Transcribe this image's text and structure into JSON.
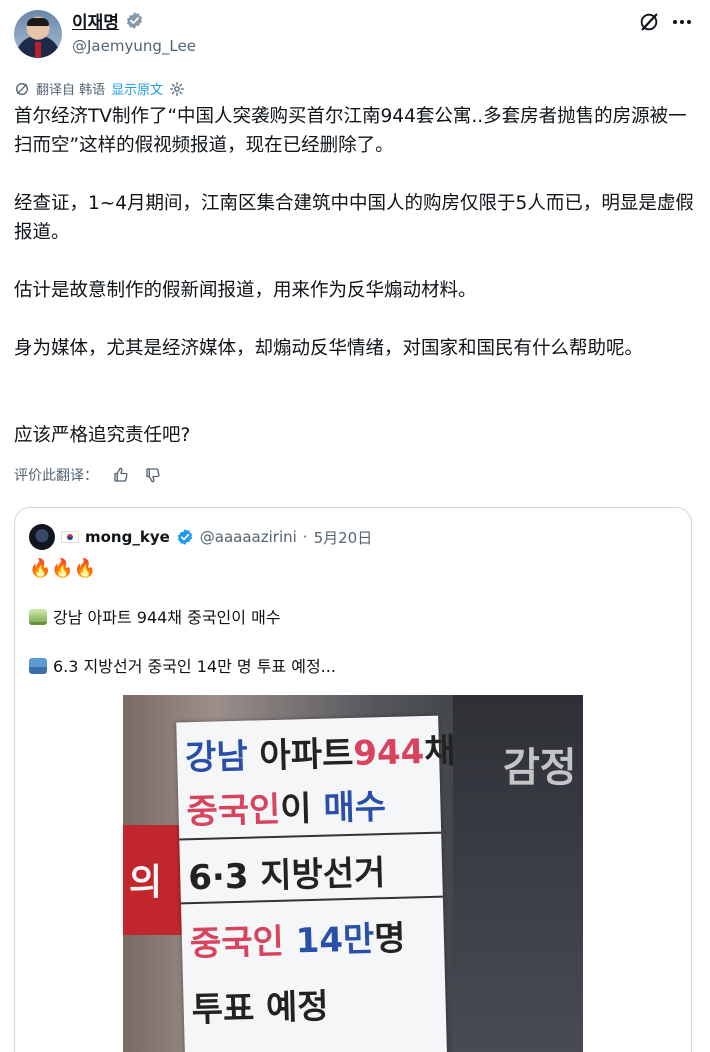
{
  "author": {
    "display_name": "이재명",
    "handle": "@Jaemyung_Lee"
  },
  "translation": {
    "label": "翻译自 韩语",
    "show_original": "显示原文"
  },
  "tweet": {
    "paragraphs": [
      "首尔经济TV制作了“中国人突袭购买首尔江南944套公寓..多套房者抛售的房源被一扫而空”这样的假视频报道，现在已经删除了。",
      "经查证，1~4月期间，江南区集合建筑中中国人的购房仅限于5人而已，明显是虚假报道。",
      "估计是故意制作的假新闻报道，用来作为反华煽动材料。",
      "身为媒体，尤其是经济媒体，却煽动反华情绪，对国家和国民有什么帮助呢。",
      "应该严格追究责任吧?"
    ]
  },
  "rate_translation": {
    "label": "评价此翻译："
  },
  "quoted": {
    "name": "mong_kye",
    "handle": "@aaaaazirini",
    "separator": "·",
    "date": "5月20日",
    "fire": "🔥🔥🔥",
    "line1": "강남 아파트 944채 중국인이 매수",
    "line2": "6.3 지방선거 중국인 14만 명 투표 예정..."
  },
  "photo": {
    "board_lines": [
      {
        "parts": [
          {
            "t": "강남",
            "c": "blue"
          },
          {
            "t": " 아파트",
            "c": "blk"
          },
          {
            "t": "944",
            "c": "red"
          },
          {
            "t": "채",
            "c": "blk"
          }
        ]
      },
      {
        "parts": [
          {
            "t": "중국인",
            "c": "red"
          },
          {
            "t": "이 ",
            "c": "blk"
          },
          {
            "t": "매수",
            "c": "blue"
          }
        ]
      },
      {
        "parts": [
          {
            "t": "6·3 지방선거",
            "c": "blk"
          }
        ]
      },
      {
        "parts": [
          {
            "t": "중국인 ",
            "c": "red"
          },
          {
            "t": "14만",
            "c": "blue"
          },
          {
            "t": "명",
            "c": "blk"
          }
        ]
      },
      {
        "parts": [
          {
            "t": "투표 예정",
            "c": "blk"
          }
        ]
      }
    ],
    "bg_sign": "감정",
    "red_sign": "의"
  },
  "colors": {
    "accent": "#1d9bf0",
    "muted": "#536471",
    "verified": "#829aab"
  },
  "icons": {
    "verified": "verified-badge-icon",
    "grok": "grok-icon",
    "more": "more-icon",
    "translate": "translate-icon",
    "settings": "gear-icon",
    "thumbs_up": "thumbs-up-icon",
    "thumbs_down": "thumbs-down-icon"
  }
}
